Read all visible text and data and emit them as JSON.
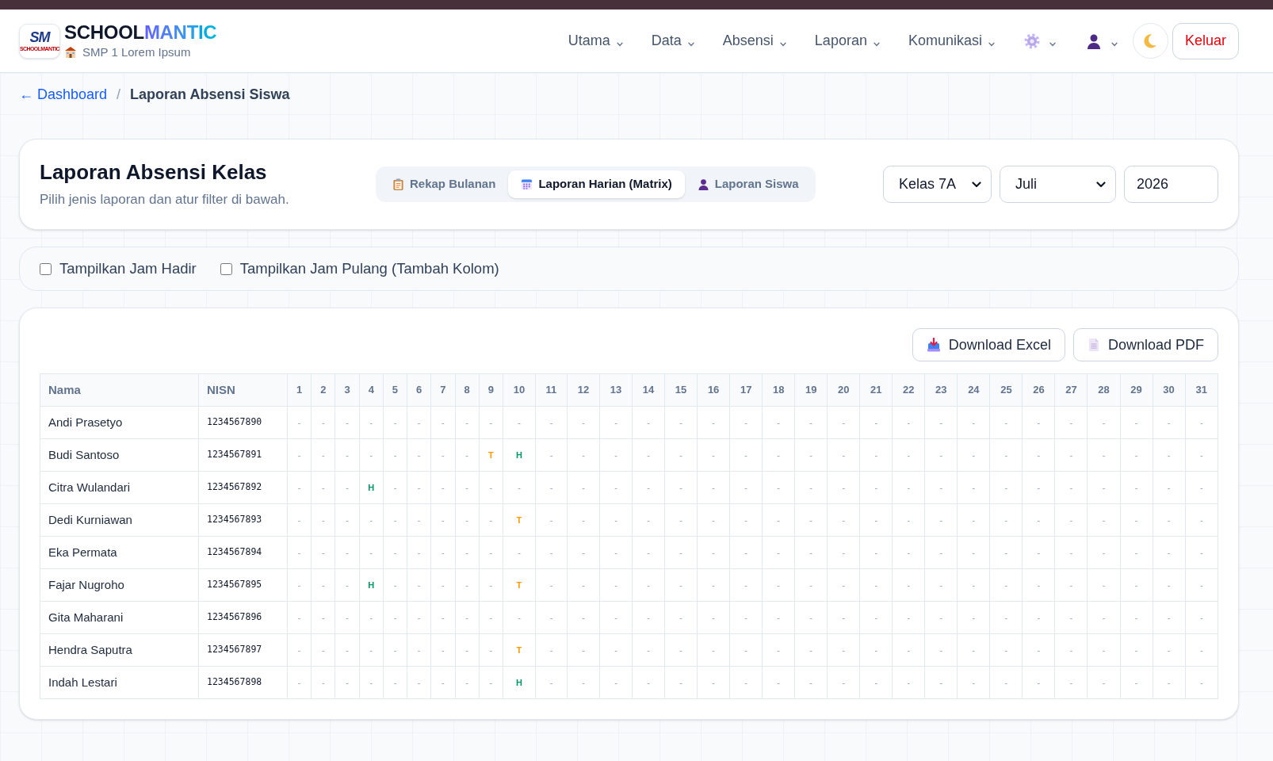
{
  "brand": {
    "logo_mark": "SM",
    "logo_caption": "SCHOOLMANTIC",
    "title_start": "SCHOOL",
    "title_accent": "MANTIC",
    "school": "SMP 1 Lorem Ipsum"
  },
  "nav": {
    "menus": [
      {
        "label": "Utama"
      },
      {
        "label": "Data"
      },
      {
        "label": "Absensi"
      },
      {
        "label": "Laporan"
      },
      {
        "label": "Komunikasi"
      }
    ],
    "logout": "Keluar"
  },
  "breadcrumb": {
    "back_link": "← Dashboard",
    "separator": "/",
    "current": "Laporan Absensi Siswa"
  },
  "report_card": {
    "title": "Laporan Absensi Kelas",
    "subtitle": "Pilih jenis laporan dan atur filter di bawah.",
    "tabs": [
      {
        "label": "Rekap Bulanan",
        "selected": false
      },
      {
        "label": "Laporan Harian (Matrix)",
        "selected": true
      },
      {
        "label": "Laporan Siswa",
        "selected": false
      }
    ],
    "class_select": "Kelas 7A",
    "month_select": "Juli",
    "year_input": "2026"
  },
  "options": [
    {
      "label": "Tampilkan Jam Hadir",
      "checked": false
    },
    {
      "label": "Tampilkan Jam Pulang (Tambah Kolom)",
      "checked": false
    }
  ],
  "downloads": [
    {
      "label": "Download Excel",
      "kind": "excel"
    },
    {
      "label": "Download PDF",
      "kind": "pdf"
    }
  ],
  "table": {
    "columns": [
      "Nama",
      "NISN",
      "1",
      "2",
      "3",
      "4",
      "5",
      "6",
      "7",
      "8",
      "9",
      "10",
      "11",
      "12",
      "13",
      "14",
      "15",
      "16",
      "17",
      "18",
      "19",
      "20",
      "21",
      "22",
      "23",
      "24",
      "25",
      "26",
      "27",
      "28",
      "29",
      "30",
      "31"
    ],
    "rows": [
      {
        "name": "Andi Prasetyo",
        "nisn": "1234567890",
        "days": [
          {
            "text": "-",
            "kind": "none"
          },
          {
            "text": "-",
            "kind": "none"
          },
          {
            "text": "-",
            "kind": "none"
          },
          {
            "text": "-",
            "kind": "none"
          },
          {
            "text": "-",
            "kind": "none"
          },
          {
            "text": "-",
            "kind": "none"
          },
          {
            "text": "-",
            "kind": "none"
          },
          {
            "text": "-",
            "kind": "none"
          },
          {
            "text": "-",
            "kind": "none"
          },
          {
            "text": "-",
            "kind": "none"
          },
          {
            "text": "-",
            "kind": "none"
          },
          {
            "text": "-",
            "kind": "none"
          },
          {
            "text": "-",
            "kind": "none"
          },
          {
            "text": "-",
            "kind": "none"
          },
          {
            "text": "-",
            "kind": "none"
          },
          {
            "text": "-",
            "kind": "none"
          },
          {
            "text": "-",
            "kind": "none"
          },
          {
            "text": "-",
            "kind": "none"
          },
          {
            "text": "-",
            "kind": "none"
          },
          {
            "text": "-",
            "kind": "none"
          },
          {
            "text": "-",
            "kind": "none"
          },
          {
            "text": "-",
            "kind": "none"
          },
          {
            "text": "-",
            "kind": "none"
          },
          {
            "text": "-",
            "kind": "none"
          },
          {
            "text": "-",
            "kind": "none"
          },
          {
            "text": "-",
            "kind": "none"
          },
          {
            "text": "-",
            "kind": "none"
          },
          {
            "text": "-",
            "kind": "none"
          },
          {
            "text": "-",
            "kind": "none"
          },
          {
            "text": "-",
            "kind": "none"
          },
          {
            "text": "-",
            "kind": "none"
          }
        ]
      },
      {
        "name": "Budi Santoso",
        "nisn": "1234567891",
        "days": [
          {
            "text": "-",
            "kind": "none"
          },
          {
            "text": "-",
            "kind": "none"
          },
          {
            "text": "-",
            "kind": "none"
          },
          {
            "text": "-",
            "kind": "none"
          },
          {
            "text": "-",
            "kind": "none"
          },
          {
            "text": "-",
            "kind": "none"
          },
          {
            "text": "-",
            "kind": "none"
          },
          {
            "text": "-",
            "kind": "none"
          },
          {
            "text": "T",
            "kind": "late"
          },
          {
            "text": "H",
            "kind": "present"
          },
          {
            "text": "-",
            "kind": "none"
          },
          {
            "text": "-",
            "kind": "none"
          },
          {
            "text": "-",
            "kind": "none"
          },
          {
            "text": "-",
            "kind": "none"
          },
          {
            "text": "-",
            "kind": "none"
          },
          {
            "text": "-",
            "kind": "none"
          },
          {
            "text": "-",
            "kind": "none"
          },
          {
            "text": "-",
            "kind": "none"
          },
          {
            "text": "-",
            "kind": "none"
          },
          {
            "text": "-",
            "kind": "none"
          },
          {
            "text": "-",
            "kind": "none"
          },
          {
            "text": "-",
            "kind": "none"
          },
          {
            "text": "-",
            "kind": "none"
          },
          {
            "text": "-",
            "kind": "none"
          },
          {
            "text": "-",
            "kind": "none"
          },
          {
            "text": "-",
            "kind": "none"
          },
          {
            "text": "-",
            "kind": "none"
          },
          {
            "text": "-",
            "kind": "none"
          },
          {
            "text": "-",
            "kind": "none"
          },
          {
            "text": "-",
            "kind": "none"
          },
          {
            "text": "-",
            "kind": "none"
          }
        ]
      },
      {
        "name": "Citra Wulandari",
        "nisn": "1234567892",
        "days": [
          {
            "text": "-",
            "kind": "none"
          },
          {
            "text": "-",
            "kind": "none"
          },
          {
            "text": "-",
            "kind": "none"
          },
          {
            "text": "H",
            "kind": "present"
          },
          {
            "text": "-",
            "kind": "none"
          },
          {
            "text": "-",
            "kind": "none"
          },
          {
            "text": "-",
            "kind": "none"
          },
          {
            "text": "-",
            "kind": "none"
          },
          {
            "text": "-",
            "kind": "none"
          },
          {
            "text": "-",
            "kind": "none"
          },
          {
            "text": "-",
            "kind": "none"
          },
          {
            "text": "-",
            "kind": "none"
          },
          {
            "text": "-",
            "kind": "none"
          },
          {
            "text": "-",
            "kind": "none"
          },
          {
            "text": "-",
            "kind": "none"
          },
          {
            "text": "-",
            "kind": "none"
          },
          {
            "text": "-",
            "kind": "none"
          },
          {
            "text": "-",
            "kind": "none"
          },
          {
            "text": "-",
            "kind": "none"
          },
          {
            "text": "-",
            "kind": "none"
          },
          {
            "text": "-",
            "kind": "none"
          },
          {
            "text": "-",
            "kind": "none"
          },
          {
            "text": "-",
            "kind": "none"
          },
          {
            "text": "-",
            "kind": "none"
          },
          {
            "text": "-",
            "kind": "none"
          },
          {
            "text": "-",
            "kind": "none"
          },
          {
            "text": "-",
            "kind": "none"
          },
          {
            "text": "-",
            "kind": "none"
          },
          {
            "text": "-",
            "kind": "none"
          },
          {
            "text": "-",
            "kind": "none"
          },
          {
            "text": "-",
            "kind": "none"
          }
        ]
      },
      {
        "name": "Dedi Kurniawan",
        "nisn": "1234567893",
        "days": [
          {
            "text": "-",
            "kind": "none"
          },
          {
            "text": "-",
            "kind": "none"
          },
          {
            "text": "-",
            "kind": "none"
          },
          {
            "text": "-",
            "kind": "none"
          },
          {
            "text": "-",
            "kind": "none"
          },
          {
            "text": "-",
            "kind": "none"
          },
          {
            "text": "-",
            "kind": "none"
          },
          {
            "text": "-",
            "kind": "none"
          },
          {
            "text": "-",
            "kind": "none"
          },
          {
            "text": "T",
            "kind": "late"
          },
          {
            "text": "-",
            "kind": "none"
          },
          {
            "text": "-",
            "kind": "none"
          },
          {
            "text": "-",
            "kind": "none"
          },
          {
            "text": "-",
            "kind": "none"
          },
          {
            "text": "-",
            "kind": "none"
          },
          {
            "text": "-",
            "kind": "none"
          },
          {
            "text": "-",
            "kind": "none"
          },
          {
            "text": "-",
            "kind": "none"
          },
          {
            "text": "-",
            "kind": "none"
          },
          {
            "text": "-",
            "kind": "none"
          },
          {
            "text": "-",
            "kind": "none"
          },
          {
            "text": "-",
            "kind": "none"
          },
          {
            "text": "-",
            "kind": "none"
          },
          {
            "text": "-",
            "kind": "none"
          },
          {
            "text": "-",
            "kind": "none"
          },
          {
            "text": "-",
            "kind": "none"
          },
          {
            "text": "-",
            "kind": "none"
          },
          {
            "text": "-",
            "kind": "none"
          },
          {
            "text": "-",
            "kind": "none"
          },
          {
            "text": "-",
            "kind": "none"
          },
          {
            "text": "-",
            "kind": "none"
          }
        ]
      },
      {
        "name": "Eka Permata",
        "nisn": "1234567894",
        "days": [
          {
            "text": "-",
            "kind": "none"
          },
          {
            "text": "-",
            "kind": "none"
          },
          {
            "text": "-",
            "kind": "none"
          },
          {
            "text": "-",
            "kind": "none"
          },
          {
            "text": "-",
            "kind": "none"
          },
          {
            "text": "-",
            "kind": "none"
          },
          {
            "text": "-",
            "kind": "none"
          },
          {
            "text": "-",
            "kind": "none"
          },
          {
            "text": "-",
            "kind": "none"
          },
          {
            "text": "-",
            "kind": "none"
          },
          {
            "text": "-",
            "kind": "none"
          },
          {
            "text": "-",
            "kind": "none"
          },
          {
            "text": "-",
            "kind": "none"
          },
          {
            "text": "-",
            "kind": "none"
          },
          {
            "text": "-",
            "kind": "none"
          },
          {
            "text": "-",
            "kind": "none"
          },
          {
            "text": "-",
            "kind": "none"
          },
          {
            "text": "-",
            "kind": "none"
          },
          {
            "text": "-",
            "kind": "none"
          },
          {
            "text": "-",
            "kind": "none"
          },
          {
            "text": "-",
            "kind": "none"
          },
          {
            "text": "-",
            "kind": "none"
          },
          {
            "text": "-",
            "kind": "none"
          },
          {
            "text": "-",
            "kind": "none"
          },
          {
            "text": "-",
            "kind": "none"
          },
          {
            "text": "-",
            "kind": "none"
          },
          {
            "text": "-",
            "kind": "none"
          },
          {
            "text": "-",
            "kind": "none"
          },
          {
            "text": "-",
            "kind": "none"
          },
          {
            "text": "-",
            "kind": "none"
          },
          {
            "text": "-",
            "kind": "none"
          }
        ]
      },
      {
        "name": "Fajar Nugroho",
        "nisn": "1234567895",
        "days": [
          {
            "text": "-",
            "kind": "none"
          },
          {
            "text": "-",
            "kind": "none"
          },
          {
            "text": "-",
            "kind": "none"
          },
          {
            "text": "H",
            "kind": "present"
          },
          {
            "text": "-",
            "kind": "none"
          },
          {
            "text": "-",
            "kind": "none"
          },
          {
            "text": "-",
            "kind": "none"
          },
          {
            "text": "-",
            "kind": "none"
          },
          {
            "text": "-",
            "kind": "none"
          },
          {
            "text": "T",
            "kind": "late"
          },
          {
            "text": "-",
            "kind": "none"
          },
          {
            "text": "-",
            "kind": "none"
          },
          {
            "text": "-",
            "kind": "none"
          },
          {
            "text": "-",
            "kind": "none"
          },
          {
            "text": "-",
            "kind": "none"
          },
          {
            "text": "-",
            "kind": "none"
          },
          {
            "text": "-",
            "kind": "none"
          },
          {
            "text": "-",
            "kind": "none"
          },
          {
            "text": "-",
            "kind": "none"
          },
          {
            "text": "-",
            "kind": "none"
          },
          {
            "text": "-",
            "kind": "none"
          },
          {
            "text": "-",
            "kind": "none"
          },
          {
            "text": "-",
            "kind": "none"
          },
          {
            "text": "-",
            "kind": "none"
          },
          {
            "text": "-",
            "kind": "none"
          },
          {
            "text": "-",
            "kind": "none"
          },
          {
            "text": "-",
            "kind": "none"
          },
          {
            "text": "-",
            "kind": "none"
          },
          {
            "text": "-",
            "kind": "none"
          },
          {
            "text": "-",
            "kind": "none"
          },
          {
            "text": "-",
            "kind": "none"
          }
        ]
      },
      {
        "name": "Gita Maharani",
        "nisn": "1234567896",
        "days": [
          {
            "text": "-",
            "kind": "none"
          },
          {
            "text": "-",
            "kind": "none"
          },
          {
            "text": "-",
            "kind": "none"
          },
          {
            "text": "-",
            "kind": "none"
          },
          {
            "text": "-",
            "kind": "none"
          },
          {
            "text": "-",
            "kind": "none"
          },
          {
            "text": "-",
            "kind": "none"
          },
          {
            "text": "-",
            "kind": "none"
          },
          {
            "text": "-",
            "kind": "none"
          },
          {
            "text": "-",
            "kind": "none"
          },
          {
            "text": "-",
            "kind": "none"
          },
          {
            "text": "-",
            "kind": "none"
          },
          {
            "text": "-",
            "kind": "none"
          },
          {
            "text": "-",
            "kind": "none"
          },
          {
            "text": "-",
            "kind": "none"
          },
          {
            "text": "-",
            "kind": "none"
          },
          {
            "text": "-",
            "kind": "none"
          },
          {
            "text": "-",
            "kind": "none"
          },
          {
            "text": "-",
            "kind": "none"
          },
          {
            "text": "-",
            "kind": "none"
          },
          {
            "text": "-",
            "kind": "none"
          },
          {
            "text": "-",
            "kind": "none"
          },
          {
            "text": "-",
            "kind": "none"
          },
          {
            "text": "-",
            "kind": "none"
          },
          {
            "text": "-",
            "kind": "none"
          },
          {
            "text": "-",
            "kind": "none"
          },
          {
            "text": "-",
            "kind": "none"
          },
          {
            "text": "-",
            "kind": "none"
          },
          {
            "text": "-",
            "kind": "none"
          },
          {
            "text": "-",
            "kind": "none"
          },
          {
            "text": "-",
            "kind": "none"
          }
        ]
      },
      {
        "name": "Hendra Saputra",
        "nisn": "1234567897",
        "days": [
          {
            "text": "-",
            "kind": "none"
          },
          {
            "text": "-",
            "kind": "none"
          },
          {
            "text": "-",
            "kind": "none"
          },
          {
            "text": "-",
            "kind": "none"
          },
          {
            "text": "-",
            "kind": "none"
          },
          {
            "text": "-",
            "kind": "none"
          },
          {
            "text": "-",
            "kind": "none"
          },
          {
            "text": "-",
            "kind": "none"
          },
          {
            "text": "-",
            "kind": "none"
          },
          {
            "text": "T",
            "kind": "late"
          },
          {
            "text": "-",
            "kind": "none"
          },
          {
            "text": "-",
            "kind": "none"
          },
          {
            "text": "-",
            "kind": "none"
          },
          {
            "text": "-",
            "kind": "none"
          },
          {
            "text": "-",
            "kind": "none"
          },
          {
            "text": "-",
            "kind": "none"
          },
          {
            "text": "-",
            "kind": "none"
          },
          {
            "text": "-",
            "kind": "none"
          },
          {
            "text": "-",
            "kind": "none"
          },
          {
            "text": "-",
            "kind": "none"
          },
          {
            "text": "-",
            "kind": "none"
          },
          {
            "text": "-",
            "kind": "none"
          },
          {
            "text": "-",
            "kind": "none"
          },
          {
            "text": "-",
            "kind": "none"
          },
          {
            "text": "-",
            "kind": "none"
          },
          {
            "text": "-",
            "kind": "none"
          },
          {
            "text": "-",
            "kind": "none"
          },
          {
            "text": "-",
            "kind": "none"
          },
          {
            "text": "-",
            "kind": "none"
          },
          {
            "text": "-",
            "kind": "none"
          },
          {
            "text": "-",
            "kind": "none"
          }
        ]
      },
      {
        "name": "Indah Lestari",
        "nisn": "1234567898",
        "days": [
          {
            "text": "-",
            "kind": "none"
          },
          {
            "text": "-",
            "kind": "none"
          },
          {
            "text": "-",
            "kind": "none"
          },
          {
            "text": "-",
            "kind": "none"
          },
          {
            "text": "-",
            "kind": "none"
          },
          {
            "text": "-",
            "kind": "none"
          },
          {
            "text": "-",
            "kind": "none"
          },
          {
            "text": "-",
            "kind": "none"
          },
          {
            "text": "-",
            "kind": "none"
          },
          {
            "text": "H",
            "kind": "present"
          },
          {
            "text": "-",
            "kind": "none"
          },
          {
            "text": "-",
            "kind": "none"
          },
          {
            "text": "-",
            "kind": "none"
          },
          {
            "text": "-",
            "kind": "none"
          },
          {
            "text": "-",
            "kind": "none"
          },
          {
            "text": "-",
            "kind": "none"
          },
          {
            "text": "-",
            "kind": "none"
          },
          {
            "text": "-",
            "kind": "none"
          },
          {
            "text": "-",
            "kind": "none"
          },
          {
            "text": "-",
            "kind": "none"
          },
          {
            "text": "-",
            "kind": "none"
          },
          {
            "text": "-",
            "kind": "none"
          },
          {
            "text": "-",
            "kind": "none"
          },
          {
            "text": "-",
            "kind": "none"
          },
          {
            "text": "-",
            "kind": "none"
          },
          {
            "text": "-",
            "kind": "none"
          },
          {
            "text": "-",
            "kind": "none"
          },
          {
            "text": "-",
            "kind": "none"
          },
          {
            "text": "-",
            "kind": "none"
          },
          {
            "text": "-",
            "kind": "none"
          },
          {
            "text": "-",
            "kind": "none"
          }
        ]
      }
    ]
  }
}
